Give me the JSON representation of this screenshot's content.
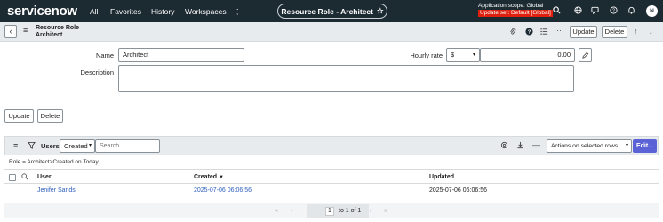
{
  "topbar": {
    "logo": "servicenow",
    "nav": [
      "All",
      "Favorites",
      "History",
      "Workspaces"
    ],
    "more": "⋮",
    "record_pill": "Resource Role - Architect",
    "scope_label": "Application scope: Global",
    "update_set": "Update set: Default [Global]",
    "avatar_initial": "N"
  },
  "record": {
    "back": "‹",
    "menu": "≡",
    "title_line1": "Resource Role",
    "title_line2": "Architect",
    "update_label": "Update",
    "delete_label": "Delete"
  },
  "form": {
    "name_label": "Name",
    "name_value": "Architect",
    "description_label": "Description",
    "description_value": "",
    "hourly_label": "Hourly rate",
    "currency": "$",
    "hourly_value": "0.00",
    "update_label": "Update",
    "delete_label": "Delete"
  },
  "list": {
    "title": "Users",
    "search_field": "Created",
    "search_placeholder": "Search",
    "actions_placeholder": "Actions on selected rows...",
    "edit_label": "Edit...",
    "breadcrumb": "Role = Architect>Created on Today",
    "columns": [
      "User",
      "Created",
      "Updated"
    ],
    "sort_indicator": "▼",
    "rows": [
      {
        "user": "Jenifer Sands",
        "created": "2025-07-06 06:06:56",
        "updated": "2025-07-06 06:06:56"
      }
    ],
    "pager_current": "1",
    "pager_text": "to 1 of 1"
  },
  "colors": {
    "topbar": "#1c2a32",
    "link": "#2c5ebd",
    "edit_button": "#5a62d6",
    "update_set": "#e0200e"
  }
}
